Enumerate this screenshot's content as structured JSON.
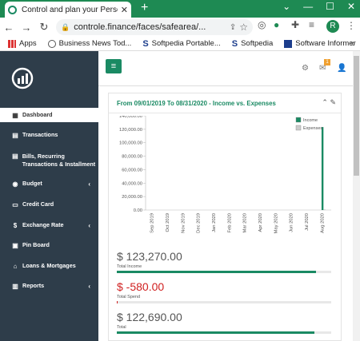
{
  "browser": {
    "tab_title": "Control and plan your Personal F",
    "url": "controle.finance/faces/safearea/...",
    "avatar_letter": "R",
    "bookmarks": [
      "Apps",
      "Business News Tod...",
      "Softpedia Portable...",
      "Softpedia",
      "Software Informer"
    ]
  },
  "sidebar": {
    "items": [
      {
        "label": "Dashboard",
        "icon": "dashboard-icon",
        "chevron": ""
      },
      {
        "label": "Transactions",
        "icon": "list-icon",
        "chevron": ""
      },
      {
        "label": "Bills, Recurring Transactions & Installment",
        "icon": "list-icon",
        "chevron": ""
      },
      {
        "label": "Budget",
        "icon": "budget-icon",
        "chevron": "‹"
      },
      {
        "label": "Credit Card",
        "icon": "credit-card-icon",
        "chevron": ""
      },
      {
        "label": "Exchange Rate",
        "icon": "dollar-icon",
        "chevron": "‹"
      },
      {
        "label": "Pin Board",
        "icon": "pin-icon",
        "chevron": ""
      },
      {
        "label": "Loans & Mortgages",
        "icon": "bank-icon",
        "chevron": ""
      },
      {
        "label": "Reports",
        "icon": "chart-icon",
        "chevron": "‹"
      }
    ]
  },
  "topbar": {
    "notif_count": "1"
  },
  "panel": {
    "title": "From 09/01/2019 To 08/31/2020 - Income vs. Expenses"
  },
  "chart_data": {
    "type": "bar",
    "categories": [
      "Sep 2019",
      "Oct 2019",
      "Nov 2019",
      "Dec 2019",
      "Jan 2020",
      "Feb 2020",
      "Mar 2020",
      "Apr 2020",
      "May 2020",
      "Jun 2020",
      "Jul 2020",
      "Aug 2020"
    ],
    "series": [
      {
        "name": "Income",
        "values": [
          0,
          0,
          0,
          0,
          0,
          0,
          0,
          0,
          0,
          0,
          0,
          123270
        ],
        "color": "#1a8a63"
      },
      {
        "name": "Expenses",
        "values": [
          0,
          0,
          0,
          0,
          0,
          0,
          0,
          0,
          0,
          0,
          0,
          580
        ],
        "color": "#cccccc"
      }
    ],
    "yticks": [
      "0.00",
      "20,000.00",
      "40,000.00",
      "60,000.00",
      "80,000.00",
      "100,000.00",
      "120,000.00",
      "140,000.00"
    ],
    "ylim": [
      0,
      140000
    ],
    "legend": "top-right"
  },
  "stats": [
    {
      "value": "$ 123,270.00",
      "label": "Total Income",
      "fill": 0.93,
      "negative": false
    },
    {
      "value": "$ -580.00",
      "label": "Total Spend",
      "fill": 0.005,
      "negative": true
    },
    {
      "value": "$ 122,690.00",
      "label": "Total",
      "fill": 0.92,
      "negative": false
    }
  ]
}
